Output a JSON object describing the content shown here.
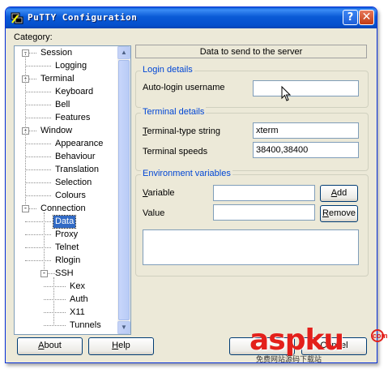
{
  "window": {
    "title": "PuTTY Configuration",
    "title_buttons": {
      "help": "?",
      "close": "✕"
    },
    "app_icon": "putty-icon"
  },
  "category": {
    "label": "Category:",
    "tree": [
      {
        "label": "Session",
        "expander": "-"
      },
      {
        "label": "Logging"
      },
      {
        "label": "Terminal",
        "expander": "-"
      },
      {
        "label": "Keyboard"
      },
      {
        "label": "Bell"
      },
      {
        "label": "Features"
      },
      {
        "label": "Window",
        "expander": "-"
      },
      {
        "label": "Appearance"
      },
      {
        "label": "Behaviour"
      },
      {
        "label": "Translation"
      },
      {
        "label": "Selection"
      },
      {
        "label": "Colours"
      },
      {
        "label": "Connection",
        "expander": "-"
      },
      {
        "label": "Data",
        "selected": true
      },
      {
        "label": "Proxy"
      },
      {
        "label": "Telnet"
      },
      {
        "label": "Rlogin"
      },
      {
        "label": "SSH",
        "expander": "-"
      },
      {
        "label": "Kex"
      },
      {
        "label": "Auth"
      },
      {
        "label": "X11"
      },
      {
        "label": "Tunnels"
      }
    ],
    "scroll_up": "▲",
    "scroll_down": "▼"
  },
  "panel": {
    "header": "Data to send to the server",
    "login": {
      "title": "Login details",
      "username_label": "Auto-login username",
      "username_value": ""
    },
    "terminal": {
      "title": "Terminal details",
      "type_label": "Terminal-type string",
      "type_value": "xterm",
      "speeds_label": "Terminal speeds",
      "speeds_value": "38400,38400"
    },
    "environment": {
      "title": "Environment variables",
      "variable_label": "Variable",
      "variable_value": "",
      "value_label": "Value",
      "value_value": "",
      "add_button": "Add",
      "remove_button": "Remove"
    }
  },
  "footer": {
    "about_button": "About",
    "help_button": "Help",
    "cancel_button": "Cancel"
  },
  "watermark": {
    "brand": "aspku",
    "badge": "com",
    "subtitle": "免费网站源码下载站"
  },
  "colors": {
    "titlebar": "#0a5ad6",
    "window_bg": "#ece9d8",
    "selection": "#316ac5",
    "group_title": "#0046d5",
    "watermark": "#e3201b"
  }
}
